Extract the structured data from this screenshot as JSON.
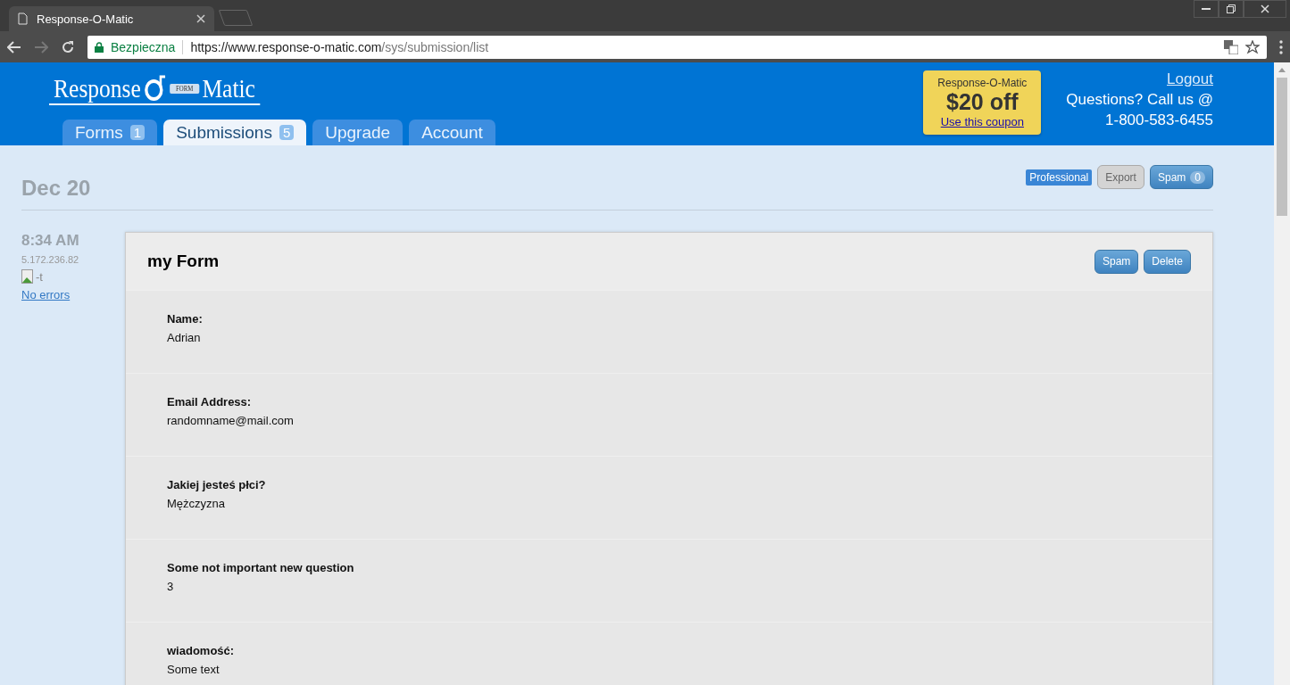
{
  "browser": {
    "tab_title": "Response-O-Matic",
    "secure_label": "Bezpieczna",
    "url_host": "https://www.response-o-matic.com",
    "url_path": "/sys/submission/list"
  },
  "logo": {
    "left": "Response",
    "right": "Matic",
    "stamp": "FORM"
  },
  "nav_tabs": [
    {
      "label": "Forms",
      "count": "1",
      "selected": false
    },
    {
      "label": "Submissions",
      "count": "5",
      "selected": true
    },
    {
      "label": "Upgrade",
      "selected": false
    },
    {
      "label": "Account",
      "selected": false
    }
  ],
  "coupon": {
    "brand": "Response-O-Matic",
    "offer": "$20 off",
    "link": "Use this coupon"
  },
  "header_links": {
    "logout": "Logout",
    "questions": "Questions? Call us @",
    "phone": "1-800-583-6455"
  },
  "date": "Dec 20",
  "toolbar": {
    "plan": "Professional",
    "export": "Export",
    "spam": "Spam",
    "spam_count": "0"
  },
  "submission": {
    "time": "8:34 AM",
    "ip": "5.172.236.82",
    "image_alt": "-t",
    "errors_link": "No errors",
    "form_title": "my Form",
    "actions": [
      "Spam",
      "Delete"
    ],
    "fields": [
      {
        "label": "Name:",
        "value": "Adrian"
      },
      {
        "label": "Email Address:",
        "value": "randomname@mail.com"
      },
      {
        "label": "Jakiej jesteś płci?",
        "value": "Mężczyzna"
      },
      {
        "label": "Some not important new question",
        "value": "3"
      },
      {
        "label": "wiadomość:",
        "value": "Some text"
      }
    ]
  }
}
